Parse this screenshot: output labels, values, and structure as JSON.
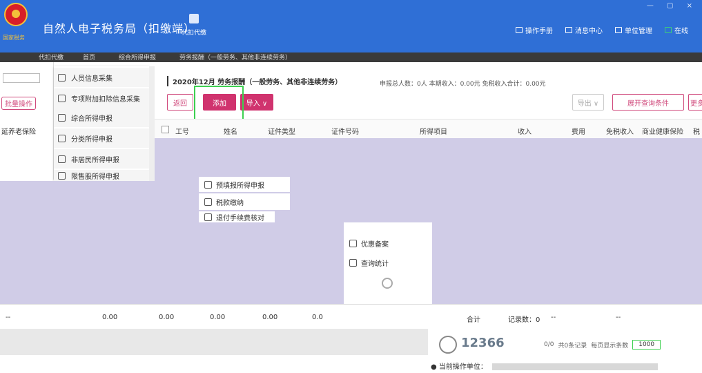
{
  "window": {
    "title": "自然人电子税务局（扣缴端）",
    "logo_text": "国家税务",
    "controls": "— ▢ ×"
  },
  "header_nav": {
    "proxy_label": "代扣代缴"
  },
  "top_links": [
    {
      "label": "操作手册",
      "icon": "book-icon"
    },
    {
      "label": "消息中心",
      "icon": "mail-icon"
    },
    {
      "label": "单位管理",
      "icon": "building-icon"
    },
    {
      "label": "在线",
      "icon": "online-icon"
    }
  ],
  "tabstrip": {
    "tab1": "代扣代缴",
    "tab2": "首页",
    "tab3": "综合所得申报",
    "tab4": "劳务报酬（一般劳务、其他非连续劳务）"
  },
  "left_panel": {
    "batch_label": "批量操作",
    "column_label": "延养老保险"
  },
  "side_menu": [
    {
      "label": "人员信息采集",
      "icon": "person-icon"
    },
    {
      "label": "专项附加扣除信息采集",
      "icon": "list-icon"
    },
    {
      "label": "综合所得申报",
      "icon": "layers-icon"
    },
    {
      "label": "分类所得申报",
      "icon": "pie-icon"
    },
    {
      "label": "非居民所得申报",
      "icon": "user-icon"
    },
    {
      "label": "限售股所得申报",
      "icon": "send-icon"
    }
  ],
  "floating_menu": [
    {
      "label": "预填报所得申报",
      "icon": "chart-icon"
    },
    {
      "label": "税款缴纳",
      "icon": "wallet-icon"
    },
    {
      "label": "退付手续费核对",
      "icon": "doc-icon"
    },
    {
      "label": "优惠备案",
      "icon": "file-icon"
    },
    {
      "label": "查询统计",
      "icon": "query-icon"
    }
  ],
  "main": {
    "heading": "2020年12月 劳务报酬（一般劳务、其他非连续劳务）",
    "summary": "申报总人数：0人  本期收入：0.00元  免税收入合计：0.00元",
    "buttons": {
      "back": "返回",
      "add": "添加",
      "import": "导入 ∨",
      "export": "导出 ∨",
      "expand": "展开查询条件",
      "more": "更多"
    },
    "columns": [
      "工号",
      "姓名",
      "证件类型",
      "证件号码",
      "所得项目",
      "收入",
      "费用",
      "免税收入",
      "商业健康保险",
      "税"
    ]
  },
  "totals": {
    "dash1": "--",
    "v1": "0.00",
    "v2": "0.00",
    "v3": "0.00",
    "v4": "0.00",
    "v5": "0.0",
    "label": "合计",
    "records": "记录数：0",
    "dash2": "--",
    "dash3": "--"
  },
  "footer": {
    "hotline": "12366",
    "pager_pages": "0/0",
    "pager_records": "共0条记录",
    "pager_size_label": "每页显示条数",
    "pager_size": "1000",
    "operator_label": "当前操作单位："
  },
  "colors": {
    "header_blue": "#2f6fd6",
    "accent_pink": "#d0336e",
    "empty_purple": "#d0cce7",
    "highlight_green": "#3dd050"
  }
}
